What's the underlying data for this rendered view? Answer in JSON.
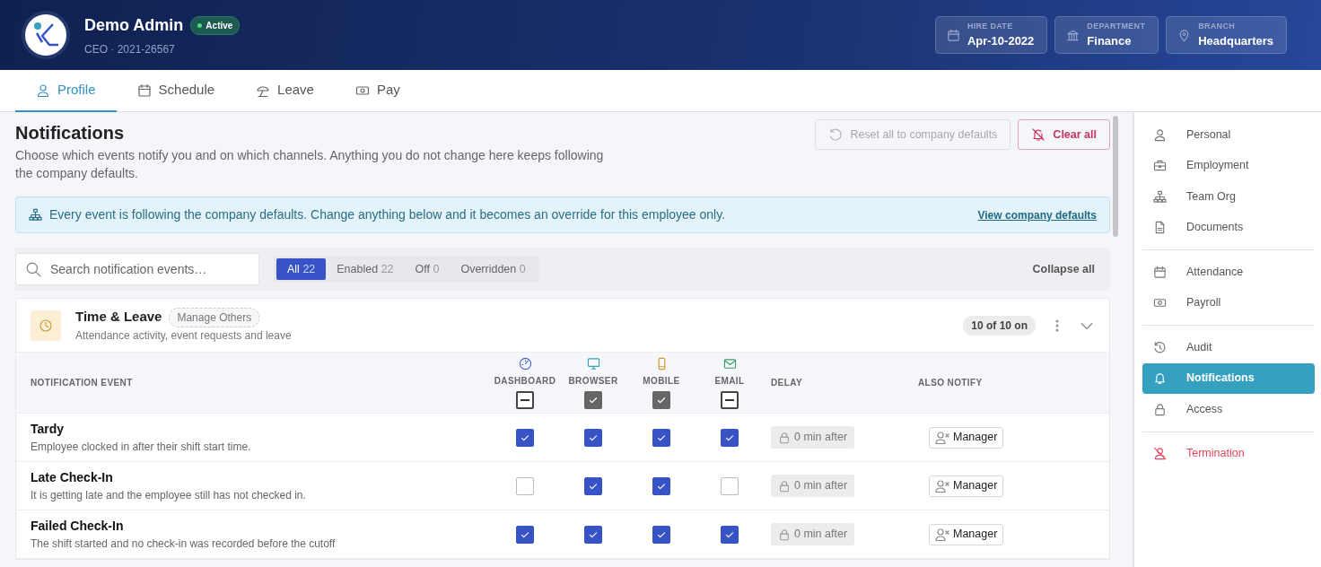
{
  "header": {
    "name": "Demo Admin",
    "status": "Active",
    "subtitle": "CEO · 2021-26567",
    "facts": [
      {
        "label": "HIRE DATE",
        "value": "Apr-10-2022",
        "kind": "calendar"
      },
      {
        "label": "DEPARTMENT",
        "value": "Finance",
        "kind": "bank"
      },
      {
        "label": "BRANCH",
        "value": "Headquarters",
        "kind": "pin"
      }
    ]
  },
  "tabs": [
    {
      "label": "Profile",
      "kind": "person",
      "selected": true
    },
    {
      "label": "Schedule",
      "kind": "calendar",
      "selected": false
    },
    {
      "label": "Leave",
      "kind": "umbrella",
      "selected": false
    },
    {
      "label": "Pay",
      "kind": "money",
      "selected": false
    }
  ],
  "page": {
    "title": "Notifications",
    "description": "Choose which events notify you and on which channels. Anything you do not change here keeps following the company defaults.",
    "buttons": [
      {
        "label": "Reset all to company defaults",
        "kind": "reset",
        "disabled": true
      },
      {
        "label": "Clear all",
        "kind": "clear",
        "disabled": false
      }
    ]
  },
  "info": {
    "text": "Every event is following the company defaults. Change anything below and it becomes an override for this employee only.",
    "link": "View company defaults"
  },
  "search": {
    "placeholder": "Search notification events…"
  },
  "filters": [
    {
      "label": "All",
      "count": "22",
      "selected": true
    },
    {
      "label": "Enabled",
      "count": "22",
      "selected": false
    },
    {
      "label": "Off",
      "count": "0",
      "selected": false
    },
    {
      "label": "Overridden",
      "count": "0",
      "selected": false
    }
  ],
  "collapse": "Collapse all",
  "group": {
    "title": "Time & Leave",
    "tag": "Manage Others",
    "subtitle": "Attendance activity, event requests and leave",
    "count": "10 of 10 on",
    "table": {
      "columns": [
        {
          "label": "NOTIFICATION EVENT"
        },
        {
          "label": "DASHBOARD",
          "kind": "dashboard",
          "indeterminate": true
        },
        {
          "label": "BROWSER",
          "kind": "browser",
          "checked": true
        },
        {
          "label": "MOBILE",
          "kind": "mobile",
          "checked": true
        },
        {
          "label": "EMAIL",
          "kind": "email",
          "indeterminate": true
        },
        {
          "label": "DELAY"
        },
        {
          "label": "ALSO NOTIFY"
        }
      ],
      "rows": [
        {
          "title": "Tardy",
          "description": "Employee clocked in after their shift start time.",
          "channels": [
            {
              "checked": true
            },
            {
              "checked": true
            },
            {
              "checked": true
            },
            {
              "checked": true
            }
          ],
          "delay": "0 min after",
          "notify": "Manager"
        },
        {
          "title": "Late Check-In",
          "description": "It is getting late and the employee still has not checked in.",
          "channels": [
            {
              "checked": false
            },
            {
              "checked": true
            },
            {
              "checked": true
            },
            {
              "checked": false
            }
          ],
          "delay": "0 min after",
          "notify": "Manager"
        },
        {
          "title": "Failed Check-In",
          "description": "The shift started and no check-in was recorded before the cutoff",
          "channels": [
            {
              "checked": true
            },
            {
              "checked": true
            },
            {
              "checked": true
            },
            {
              "checked": true
            }
          ],
          "delay": "0 min after",
          "notify": "Manager"
        }
      ]
    }
  },
  "sidebar": {
    "sections": [
      {
        "items": [
          {
            "label": "Personal",
            "kind": "person",
            "selected": false
          },
          {
            "label": "Employment",
            "kind": "briefcase",
            "selected": false
          },
          {
            "label": "Team Org",
            "kind": "org",
            "selected": false
          },
          {
            "label": "Documents",
            "kind": "document",
            "selected": false
          }
        ]
      },
      {
        "items": [
          {
            "label": "Attendance",
            "kind": "calendar",
            "selected": false
          },
          {
            "label": "Payroll",
            "kind": "money",
            "selected": false
          }
        ]
      },
      {
        "items": [
          {
            "label": "Audit",
            "kind": "history",
            "selected": false
          },
          {
            "label": "Notifications",
            "kind": "bell",
            "selected": true
          },
          {
            "label": "Access",
            "kind": "lock",
            "selected": false
          }
        ]
      },
      {
        "items": [
          {
            "label": "Termination",
            "kind": "termination",
            "selected": false
          }
        ]
      }
    ]
  }
}
